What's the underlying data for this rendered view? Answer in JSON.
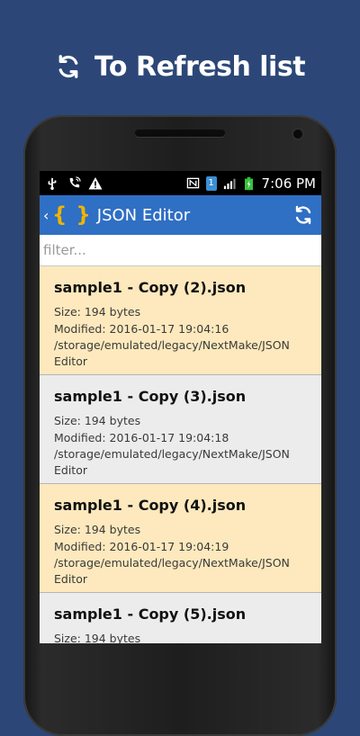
{
  "promo": {
    "text": "To Refresh list",
    "icon": "refresh-icon"
  },
  "statusbar": {
    "left_icons": [
      "usb-icon",
      "wifi-call-icon",
      "warning-icon"
    ],
    "right_icons": [
      "nfc-icon",
      "sim-icon",
      "signal-icon",
      "battery-icon"
    ],
    "sim_number": "1",
    "time": "7:06 PM"
  },
  "actionbar": {
    "logo": "{ }",
    "title": "JSON Editor",
    "refresh_icon": "refresh-icon"
  },
  "filter": {
    "placeholder": "filter...",
    "value": ""
  },
  "files": [
    {
      "name": "sample1 - Copy (2).json",
      "size": "Size: 194 bytes",
      "modified": "Modified: 2016-01-17 19:04:16",
      "path": "/storage/emulated/legacy/NextMake/JSON Editor"
    },
    {
      "name": "sample1 - Copy (3).json",
      "size": "Size: 194 bytes",
      "modified": "Modified: 2016-01-17 19:04:18",
      "path": "/storage/emulated/legacy/NextMake/JSON Editor"
    },
    {
      "name": "sample1 - Copy (4).json",
      "size": "Size: 194 bytes",
      "modified": "Modified: 2016-01-17 19:04:19",
      "path": "/storage/emulated/legacy/NextMake/JSON Editor"
    },
    {
      "name": "sample1 - Copy (5).json",
      "size": "Size: 194 bytes",
      "modified": "",
      "path": ""
    }
  ],
  "colors": {
    "background": "#2c4777",
    "actionbar": "#2f6fc4",
    "row_highlight": "#fde9bd",
    "row_alt": "#ececec",
    "logo": "#f0b400"
  }
}
